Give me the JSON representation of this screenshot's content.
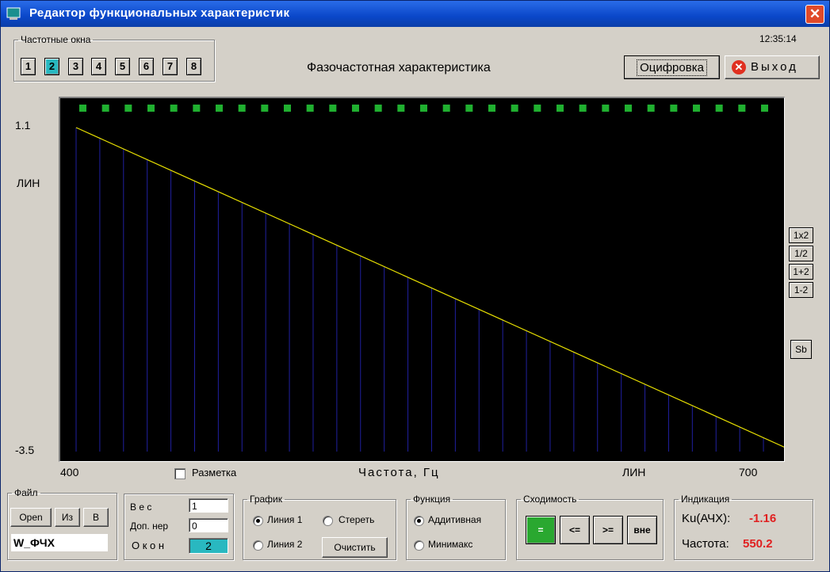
{
  "window": {
    "title": "Редактор функциональных характеристик",
    "close_symbol": "✕"
  },
  "clock": "12:35:14",
  "freq_windows": {
    "legend": "Частотные окна",
    "buttons": [
      "1",
      "2",
      "3",
      "4",
      "5",
      "6",
      "7",
      "8"
    ],
    "active": "2"
  },
  "chart_title": "Фазочастотная характеристика",
  "toolbar": {
    "digitize_label": "Оцифровка",
    "exit_label": "Выход"
  },
  "plot": {
    "ymax_label": "1.1",
    "ymin_label": "-3.5",
    "yscale_label": "ЛИН",
    "xmin_label": "400",
    "xmax_label": "700",
    "xscale_label": "ЛИН",
    "xaxis_label": "Частота, Гц",
    "markup_label": "Разметка",
    "colors": {
      "background": "#000000",
      "line": "#e8e000",
      "stems": "#2020a0",
      "markers": "#20b030"
    }
  },
  "chart_data": {
    "type": "line",
    "title": "Фазочастотная характеристика",
    "xlabel": "Частота, Гц",
    "ylabel": "",
    "xlim": [
      400,
      700
    ],
    "ylim": [
      -3.5,
      1.1
    ],
    "x": [
      400,
      710
    ],
    "y": [
      1.1,
      -3.5
    ],
    "stem_count": 31,
    "marker_count": 31,
    "grid": false
  },
  "side_buttons": [
    "1x2",
    "1/2",
    "1+2",
    "1-2",
    "Sb"
  ],
  "file": {
    "legend": "Файл",
    "open_label": "Open",
    "from_label": "Из",
    "to_label": "В",
    "name": "W_ФЧХ"
  },
  "weights": {
    "weight_label": "В е с",
    "weight_value": "1",
    "extra_label": "Доп. нер",
    "extra_value": "0",
    "windows_label": "О к о н",
    "windows_value": "2"
  },
  "graph": {
    "legend": "График",
    "line1": "Линия 1",
    "erase": "Стереть",
    "line2": "Линия 2",
    "clear": "Очистить"
  },
  "function": {
    "legend": "Функция",
    "additive": "Аддитивная",
    "minimax": "Минимакс"
  },
  "convergence": {
    "legend": "Сходимость",
    "eq": "=",
    "le": "<=",
    "ge": ">=",
    "out": "вне"
  },
  "indication": {
    "legend": "Индикация",
    "ku_label": "Ku(АЧХ):",
    "ku_value": "-1.16",
    "freq_label": "Частота:",
    "freq_value": "550.2"
  }
}
